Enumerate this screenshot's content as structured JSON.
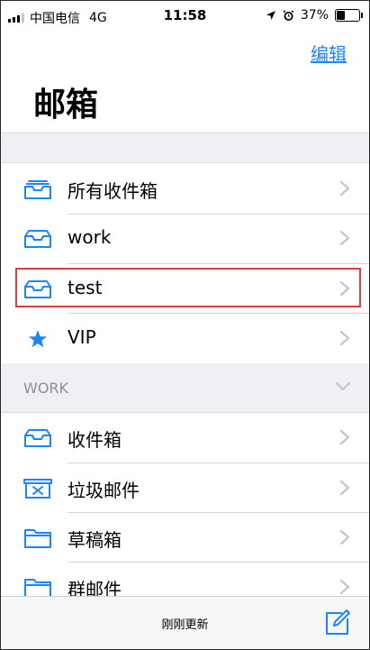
{
  "statusbar": {
    "carrier": "中国电信",
    "network": "4G",
    "time": "11:58",
    "battery": "37%",
    "battery_fraction": 0.37
  },
  "header": {
    "edit_label": "编辑",
    "title": "邮箱"
  },
  "mailboxes": [
    {
      "label": "所有收件箱",
      "icon": "tray-stack-icon"
    },
    {
      "label": "work",
      "icon": "inbox-icon"
    },
    {
      "label": "test",
      "icon": "inbox-icon",
      "highlighted": true
    },
    {
      "label": "VIP",
      "icon": "star-icon"
    }
  ],
  "section": {
    "title": "WORK",
    "expanded": true
  },
  "account_folders": [
    {
      "label": "收件箱",
      "icon": "inbox-icon"
    },
    {
      "label": "垃圾邮件",
      "icon": "junk-icon"
    },
    {
      "label": "草稿箱",
      "icon": "folder-icon"
    },
    {
      "label": "群邮件",
      "icon": "folder-icon"
    }
  ],
  "toolbar": {
    "status": "刚刚更新",
    "compose_icon": "compose-icon"
  },
  "colors": {
    "accent": "#1a85ff",
    "highlight": "#e03c3c",
    "group_bg": "#efeff4"
  }
}
